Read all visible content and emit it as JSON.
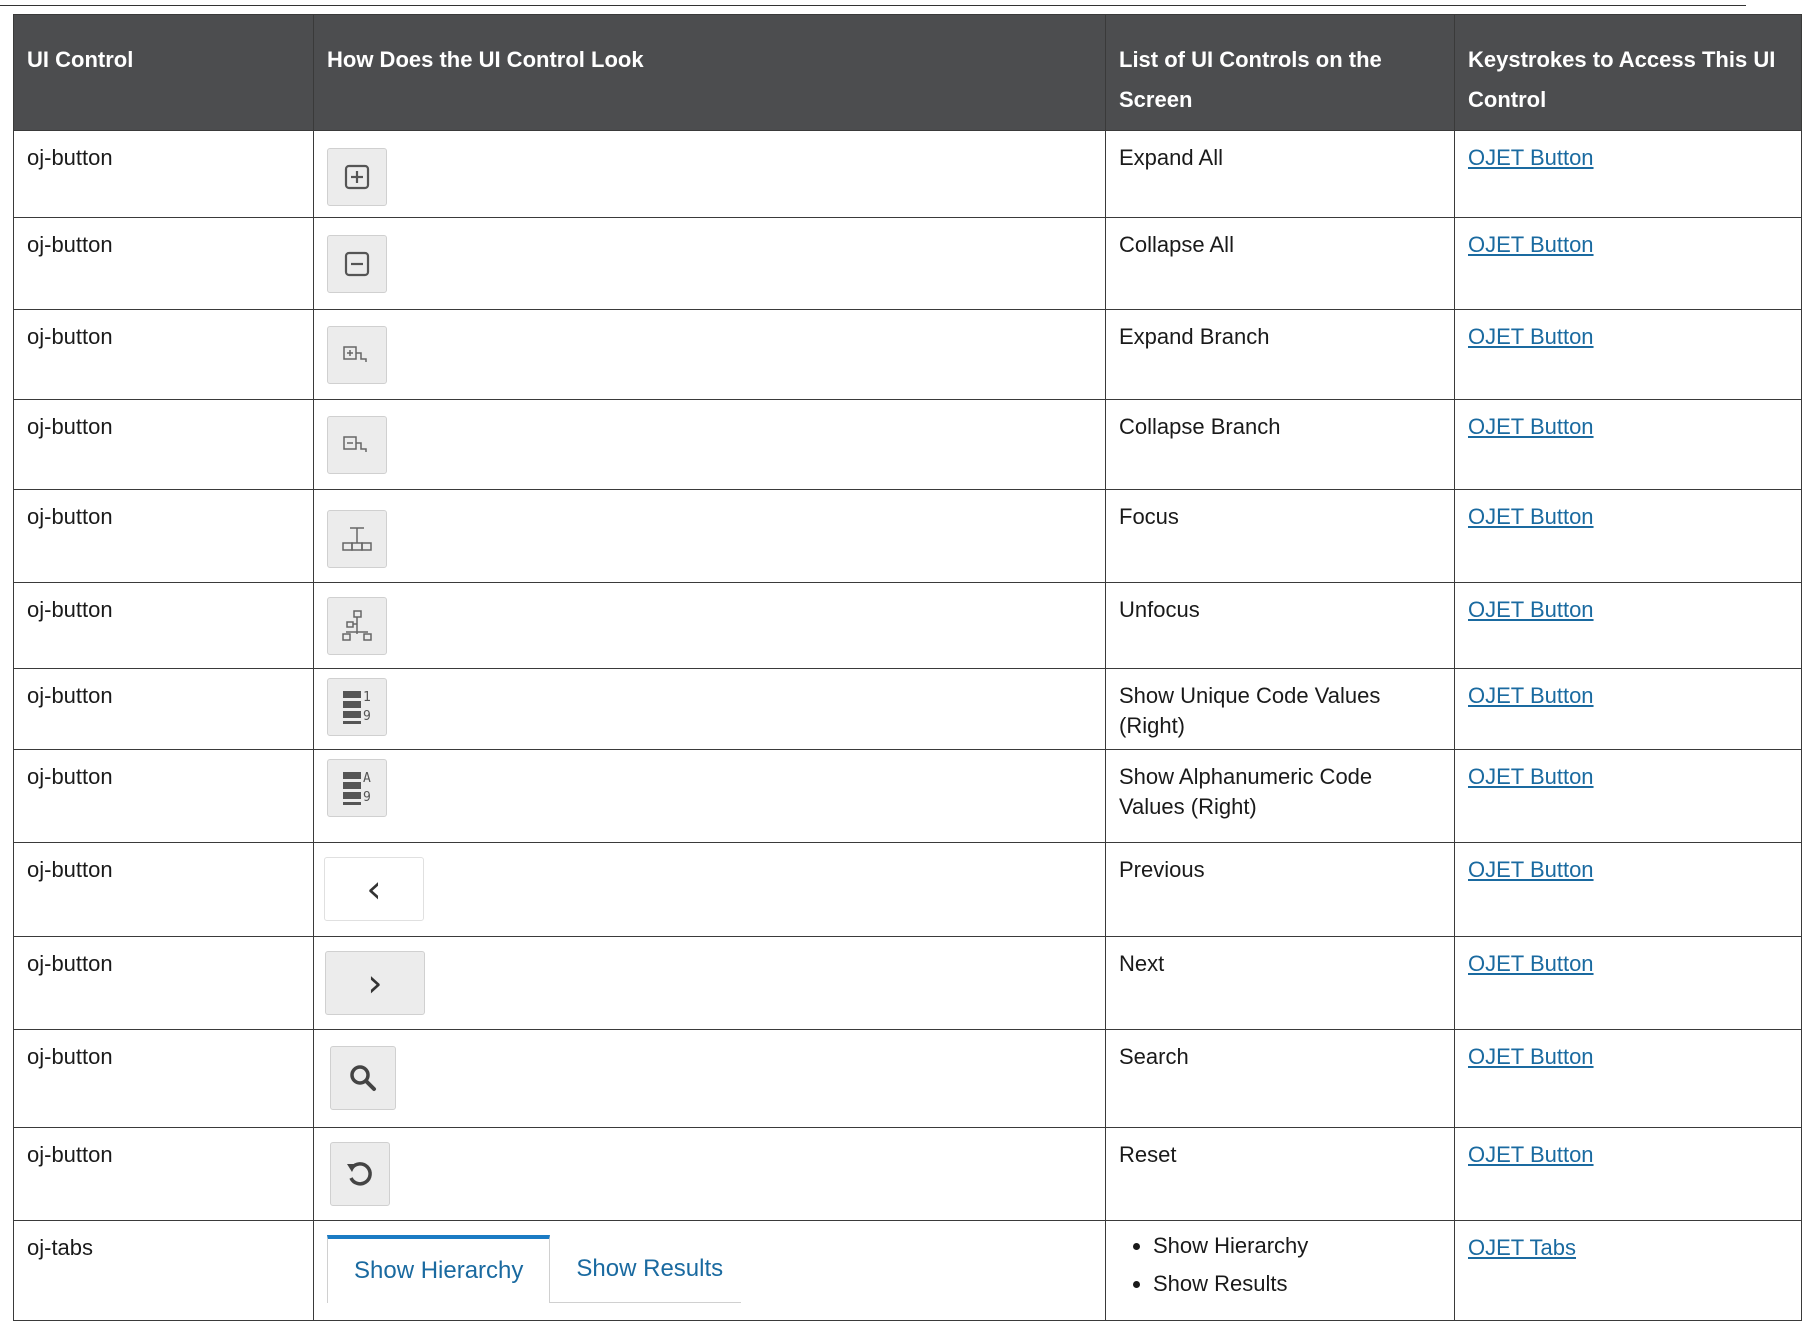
{
  "table": {
    "headers": {
      "col1": "UI Control",
      "col2": "How Does the UI Control Look",
      "col3": "List of UI Controls on the Screen",
      "col4": "Keystrokes to Access This UI Control"
    },
    "rows": [
      {
        "control": "oj-button",
        "icon": "expand-all-icon",
        "label": "Expand All",
        "link": "OJET Button"
      },
      {
        "control": "oj-button",
        "icon": "collapse-all-icon",
        "label": "Collapse All",
        "link": "OJET Button"
      },
      {
        "control": "oj-button",
        "icon": "expand-branch-icon",
        "label": "Expand Branch",
        "link": "OJET Button"
      },
      {
        "control": "oj-button",
        "icon": "collapse-branch-icon",
        "label": "Collapse Branch",
        "link": "OJET Button"
      },
      {
        "control": "oj-button",
        "icon": "focus-icon",
        "label": "Focus",
        "link": "OJET Button"
      },
      {
        "control": "oj-button",
        "icon": "unfocus-icon",
        "label": "Unfocus",
        "link": "OJET Button"
      },
      {
        "control": "oj-button",
        "icon": "unique-code-icon",
        "label": "Show Unique Code Values (Right)",
        "link": "OJET Button",
        "glyph_top": "1",
        "glyph_bottom": "9"
      },
      {
        "control": "oj-button",
        "icon": "alphanumeric-code-icon",
        "label": "Show Alphanumeric Code Values (Right)",
        "link": "OJET Button",
        "glyph_top": "A",
        "glyph_bottom": "9"
      },
      {
        "control": "oj-button",
        "icon": "chevron-left-icon",
        "label": "Previous",
        "link": "OJET Button",
        "glyph": "‹"
      },
      {
        "control": "oj-button",
        "icon": "chevron-right-icon",
        "label": "Next",
        "link": "OJET Button",
        "glyph": "›"
      },
      {
        "control": "oj-button",
        "icon": "search-icon",
        "label": "Search",
        "link": "OJET Button"
      },
      {
        "control": "oj-button",
        "icon": "reset-icon",
        "label": "Reset",
        "link": "OJET Button"
      },
      {
        "control": "oj-tabs",
        "tabs": [
          "Show Hierarchy",
          "Show Results"
        ],
        "bullets": [
          "Show Hierarchy",
          "Show Results"
        ],
        "link": "OJET Tabs"
      }
    ]
  }
}
